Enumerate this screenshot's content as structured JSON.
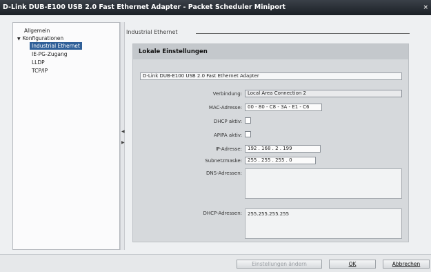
{
  "window": {
    "title": "D-Link DUB-E100 USB 2.0 Fast Ethernet Adapter - Packet Scheduler Miniport",
    "close_glyph": "×"
  },
  "tree": {
    "items": [
      {
        "label": "Allgemein"
      },
      {
        "label": "Konfigurationen",
        "expander": "▼"
      },
      {
        "label": "Industrial Ethernet"
      },
      {
        "label": "IE-PG-Zugang"
      },
      {
        "label": "LLDP"
      },
      {
        "label": "TCP/IP"
      }
    ]
  },
  "splitter": {
    "arrow_left": "◀",
    "arrow_right": "▶"
  },
  "section": {
    "title": "Industrial Ethernet"
  },
  "panel": {
    "title": "Lokale Einstellungen",
    "adapter": "D-Link DUB-E100 USB 2.0 Fast Ethernet Adapter",
    "fields": {
      "verbindung": {
        "label": "Verbindung:",
        "value": "Local Area Connection 2"
      },
      "mac": {
        "label": "MAC-Adresse:",
        "value": "00 - 80 - C8 - 3A - E1 - C6"
      },
      "dhcp": {
        "label": "DHCP aktiv:",
        "checked": false
      },
      "apipa": {
        "label": "APIPA aktiv:",
        "checked": false
      },
      "ip": {
        "label": "IP-Adresse:",
        "value": "192 . 168 . 2 . 199"
      },
      "subnet": {
        "label": "Subnetzmaske:",
        "value": "255 . 255 . 255 . 0"
      },
      "dns": {
        "label": "DNS-Adressen:",
        "value": ""
      },
      "dhcp_addr": {
        "label": "DHCP-Adressen:",
        "value": "255.255.255.255"
      }
    }
  },
  "buttons": {
    "apply": "Einstellungen ändern",
    "ok": "OK",
    "cancel": "Abbrechen"
  }
}
